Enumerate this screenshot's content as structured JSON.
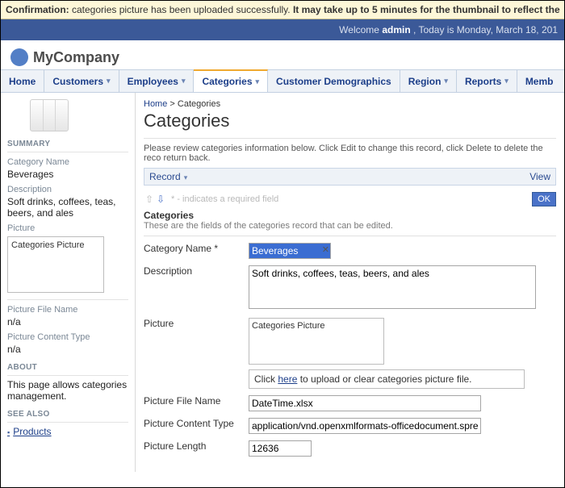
{
  "confirmation": {
    "prefix": "Confirmation:",
    "msg": "categories picture has been uploaded successfully.",
    "tail": "It may take up to 5 minutes for the thumbnail to reflect the"
  },
  "topbar": {
    "welcome": "Welcome",
    "user": "admin",
    "date": ", Today is Monday, March 18, 201"
  },
  "company": "MyCompany",
  "nav": [
    {
      "label": "Home",
      "caret": false
    },
    {
      "label": "Customers",
      "caret": true
    },
    {
      "label": "Employees",
      "caret": true
    },
    {
      "label": "Categories",
      "caret": true,
      "active": true
    },
    {
      "label": "Customer Demographics",
      "caret": false
    },
    {
      "label": "Region",
      "caret": true
    },
    {
      "label": "Reports",
      "caret": true
    },
    {
      "label": "Memb",
      "caret": false
    }
  ],
  "sidebar": {
    "summary": "SUMMARY",
    "cat_name_lbl": "Category Name",
    "cat_name_val": "Beverages",
    "desc_lbl": "Description",
    "desc_val": "Soft drinks, coffees, teas, beers, and ales",
    "pic_lbl": "Picture",
    "pic_box": "Categories Picture",
    "pfn_lbl": "Picture File Name",
    "pfn_val": "n/a",
    "pct_lbl": "Picture Content Type",
    "pct_val": "n/a",
    "about": "ABOUT",
    "about_text": "This page allows categories management.",
    "see": "SEE ALSO",
    "see_link": "Products"
  },
  "crumb": {
    "home": "Home",
    "sep": ">",
    "page": "Categories"
  },
  "heading": "Categories",
  "intro": "Please review categories information below. Click Edit to change this record, click Delete to delete the reco return back.",
  "recbar": {
    "left": "Record",
    "right": "View"
  },
  "reqnote": "* - indicates a required field",
  "ok": "OK",
  "group": {
    "title": "Categories",
    "sub": "These are the fields of the categories record that can be edited."
  },
  "form": {
    "cat_name_lbl": "Category Name",
    "cat_name_val": "Beverages",
    "desc_lbl": "Description",
    "desc_val": "Soft drinks, coffees, teas, beers, and ales",
    "pic_lbl": "Picture",
    "pic_box": "Categories Picture",
    "upload_pre": "Click ",
    "upload_link": "here",
    "upload_post": " to upload or clear categories picture file.",
    "pfn_lbl": "Picture File Name",
    "pfn_val": "DateTime.xlsx",
    "pct_lbl": "Picture Content Type",
    "pct_val": "application/vnd.openxmlformats-officedocument.sprea",
    "plen_lbl": "Picture Length",
    "plen_val": "12636"
  }
}
